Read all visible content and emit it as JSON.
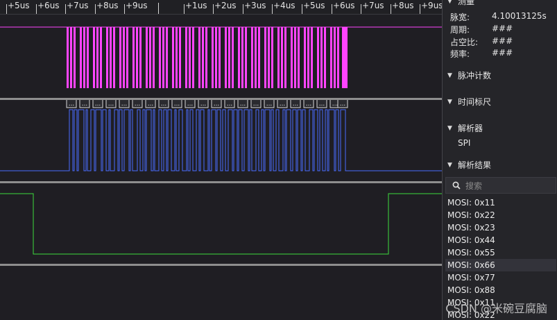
{
  "ruler": {
    "ticks": [
      {
        "label": "+5us"
      },
      {
        "label": "+6us"
      },
      {
        "label": "+7us"
      },
      {
        "label": "+8us"
      },
      {
        "label": "+9us"
      },
      {
        "label": "+1us"
      },
      {
        "label": "+2us"
      },
      {
        "label": "+3us"
      },
      {
        "label": "+4us"
      },
      {
        "label": "+5us"
      },
      {
        "label": "+6us"
      },
      {
        "label": "+7us"
      },
      {
        "label": "+8us"
      },
      {
        "label": "+9us"
      }
    ]
  },
  "colors": {
    "clock": "#ff44ff",
    "data": "#4a6cff",
    "chipselect": "#3ddc3d",
    "background": "#1f1e23",
    "panel": "#252529"
  },
  "channels": {
    "decode_marker": "..."
  },
  "sidebar": {
    "measure": {
      "header": "测量",
      "rows": [
        {
          "key": "脉宽:",
          "value": "4.10013125s"
        },
        {
          "key": "周期:",
          "value": "###"
        },
        {
          "key": "占空比:",
          "value": "###"
        },
        {
          "key": "频率:",
          "value": "###"
        }
      ]
    },
    "pulse_count": {
      "header": "脉冲计数"
    },
    "time_ruler": {
      "header": "时间标尺"
    },
    "analyzer": {
      "header": "解析器",
      "value": "SPI"
    },
    "results": {
      "header": "解析结果",
      "search_placeholder": "搜索",
      "items": [
        "MOSI: 0x11",
        "MOSI: 0x22",
        "MOSI: 0x23",
        "MOSI: 0x44",
        "MOSI: 0x55",
        "MOSI: 0x66",
        "MOSI: 0x77",
        "MOSI: 0x88",
        "MOSI: 0x11",
        "MOSI: 0x22"
      ],
      "selected_index": 5
    }
  },
  "watermark": "CSDN @米碗豆腐脑"
}
